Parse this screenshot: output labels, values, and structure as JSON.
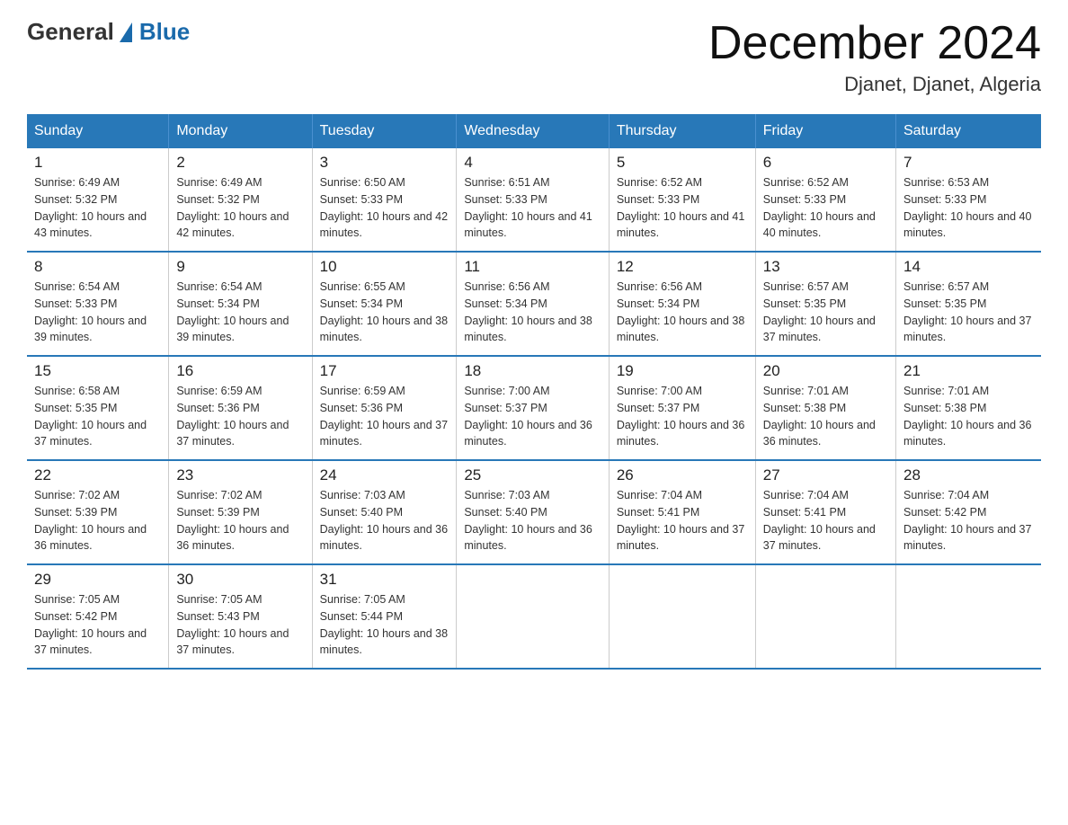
{
  "header": {
    "logo": {
      "text_general": "General",
      "text_blue": "Blue"
    },
    "month_title": "December 2024",
    "location": "Djanet, Djanet, Algeria"
  },
  "days_of_week": [
    "Sunday",
    "Monday",
    "Tuesday",
    "Wednesday",
    "Thursday",
    "Friday",
    "Saturday"
  ],
  "weeks": [
    [
      {
        "day": "1",
        "sunrise": "6:49 AM",
        "sunset": "5:32 PM",
        "daylight": "10 hours and 43 minutes."
      },
      {
        "day": "2",
        "sunrise": "6:49 AM",
        "sunset": "5:32 PM",
        "daylight": "10 hours and 42 minutes."
      },
      {
        "day": "3",
        "sunrise": "6:50 AM",
        "sunset": "5:33 PM",
        "daylight": "10 hours and 42 minutes."
      },
      {
        "day": "4",
        "sunrise": "6:51 AM",
        "sunset": "5:33 PM",
        "daylight": "10 hours and 41 minutes."
      },
      {
        "day": "5",
        "sunrise": "6:52 AM",
        "sunset": "5:33 PM",
        "daylight": "10 hours and 41 minutes."
      },
      {
        "day": "6",
        "sunrise": "6:52 AM",
        "sunset": "5:33 PM",
        "daylight": "10 hours and 40 minutes."
      },
      {
        "day": "7",
        "sunrise": "6:53 AM",
        "sunset": "5:33 PM",
        "daylight": "10 hours and 40 minutes."
      }
    ],
    [
      {
        "day": "8",
        "sunrise": "6:54 AM",
        "sunset": "5:33 PM",
        "daylight": "10 hours and 39 minutes."
      },
      {
        "day": "9",
        "sunrise": "6:54 AM",
        "sunset": "5:34 PM",
        "daylight": "10 hours and 39 minutes."
      },
      {
        "day": "10",
        "sunrise": "6:55 AM",
        "sunset": "5:34 PM",
        "daylight": "10 hours and 38 minutes."
      },
      {
        "day": "11",
        "sunrise": "6:56 AM",
        "sunset": "5:34 PM",
        "daylight": "10 hours and 38 minutes."
      },
      {
        "day": "12",
        "sunrise": "6:56 AM",
        "sunset": "5:34 PM",
        "daylight": "10 hours and 38 minutes."
      },
      {
        "day": "13",
        "sunrise": "6:57 AM",
        "sunset": "5:35 PM",
        "daylight": "10 hours and 37 minutes."
      },
      {
        "day": "14",
        "sunrise": "6:57 AM",
        "sunset": "5:35 PM",
        "daylight": "10 hours and 37 minutes."
      }
    ],
    [
      {
        "day": "15",
        "sunrise": "6:58 AM",
        "sunset": "5:35 PM",
        "daylight": "10 hours and 37 minutes."
      },
      {
        "day": "16",
        "sunrise": "6:59 AM",
        "sunset": "5:36 PM",
        "daylight": "10 hours and 37 minutes."
      },
      {
        "day": "17",
        "sunrise": "6:59 AM",
        "sunset": "5:36 PM",
        "daylight": "10 hours and 37 minutes."
      },
      {
        "day": "18",
        "sunrise": "7:00 AM",
        "sunset": "5:37 PM",
        "daylight": "10 hours and 36 minutes."
      },
      {
        "day": "19",
        "sunrise": "7:00 AM",
        "sunset": "5:37 PM",
        "daylight": "10 hours and 36 minutes."
      },
      {
        "day": "20",
        "sunrise": "7:01 AM",
        "sunset": "5:38 PM",
        "daylight": "10 hours and 36 minutes."
      },
      {
        "day": "21",
        "sunrise": "7:01 AM",
        "sunset": "5:38 PM",
        "daylight": "10 hours and 36 minutes."
      }
    ],
    [
      {
        "day": "22",
        "sunrise": "7:02 AM",
        "sunset": "5:39 PM",
        "daylight": "10 hours and 36 minutes."
      },
      {
        "day": "23",
        "sunrise": "7:02 AM",
        "sunset": "5:39 PM",
        "daylight": "10 hours and 36 minutes."
      },
      {
        "day": "24",
        "sunrise": "7:03 AM",
        "sunset": "5:40 PM",
        "daylight": "10 hours and 36 minutes."
      },
      {
        "day": "25",
        "sunrise": "7:03 AM",
        "sunset": "5:40 PM",
        "daylight": "10 hours and 36 minutes."
      },
      {
        "day": "26",
        "sunrise": "7:04 AM",
        "sunset": "5:41 PM",
        "daylight": "10 hours and 37 minutes."
      },
      {
        "day": "27",
        "sunrise": "7:04 AM",
        "sunset": "5:41 PM",
        "daylight": "10 hours and 37 minutes."
      },
      {
        "day": "28",
        "sunrise": "7:04 AM",
        "sunset": "5:42 PM",
        "daylight": "10 hours and 37 minutes."
      }
    ],
    [
      {
        "day": "29",
        "sunrise": "7:05 AM",
        "sunset": "5:42 PM",
        "daylight": "10 hours and 37 minutes."
      },
      {
        "day": "30",
        "sunrise": "7:05 AM",
        "sunset": "5:43 PM",
        "daylight": "10 hours and 37 minutes."
      },
      {
        "day": "31",
        "sunrise": "7:05 AM",
        "sunset": "5:44 PM",
        "daylight": "10 hours and 38 minutes."
      },
      null,
      null,
      null,
      null
    ]
  ]
}
